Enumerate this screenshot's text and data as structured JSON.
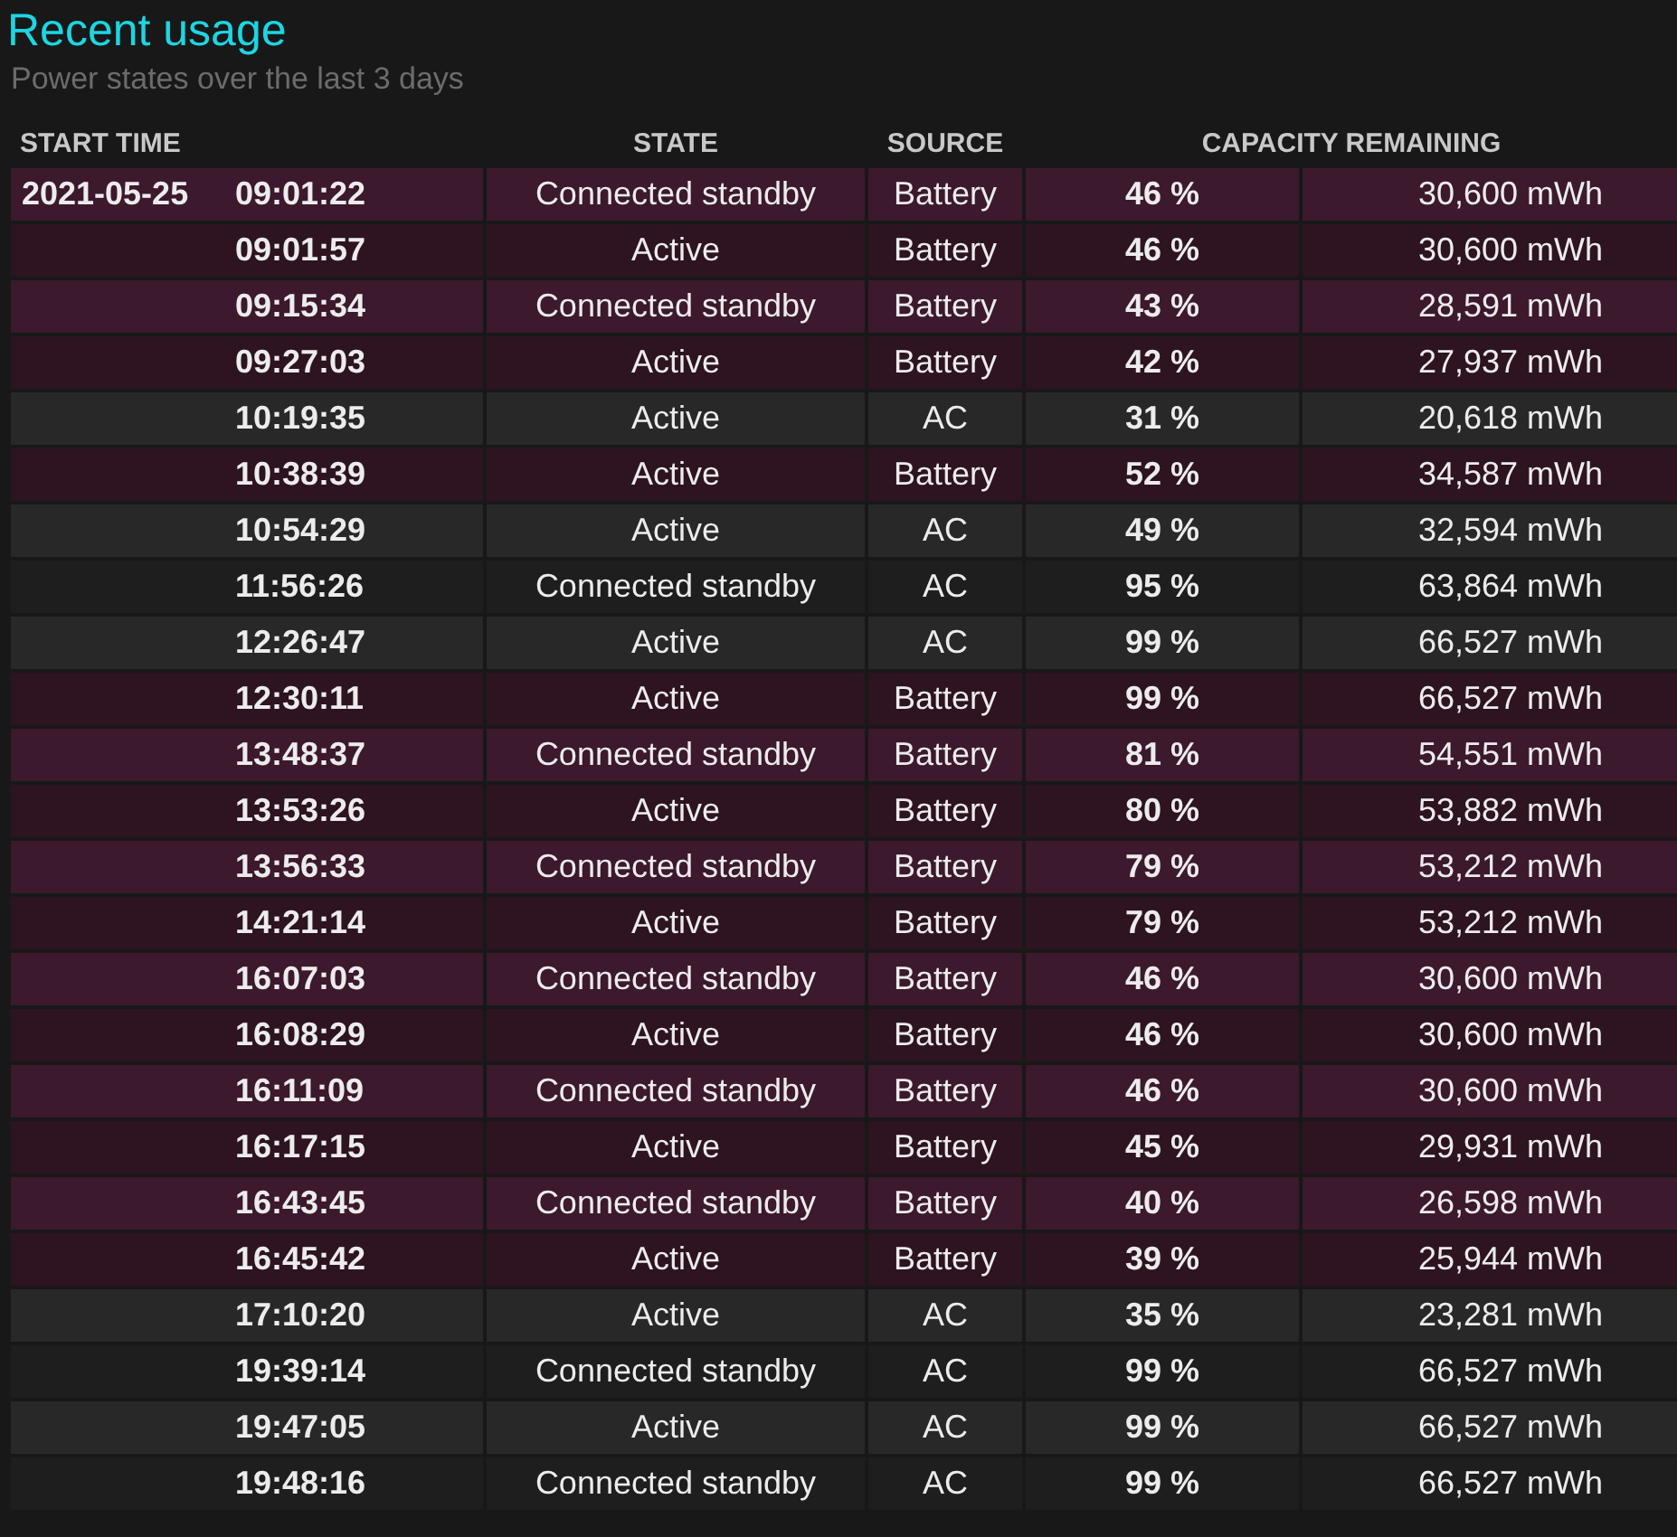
{
  "title": "Recent usage",
  "subtitle": "Power states over the last 3 days",
  "table": {
    "columns": [
      "START TIME",
      "STATE",
      "SOURCE",
      "CAPACITY REMAINING"
    ],
    "rows": [
      {
        "date": "2021-05-25",
        "time": "09:01:22",
        "state": "Connected standby",
        "source": "Battery",
        "percent": "46 %",
        "energy": "30,600 mWh",
        "color": "#3c192d"
      },
      {
        "time": "09:01:57",
        "state": "Active",
        "source": "Battery",
        "percent": "46 %",
        "energy": "30,600 mWh",
        "color": "#2d1420"
      },
      {
        "time": "09:15:34",
        "state": "Connected standby",
        "source": "Battery",
        "percent": "43 %",
        "energy": "28,591 mWh",
        "color": "#3c192d"
      },
      {
        "time": "09:27:03",
        "state": "Active",
        "source": "Battery",
        "percent": "42 %",
        "energy": "27,937 mWh",
        "color": "#2d1420"
      },
      {
        "time": "10:19:35",
        "state": "Active",
        "source": "AC",
        "percent": "31 %",
        "energy": "20,618 mWh",
        "color": "#282828"
      },
      {
        "time": "10:38:39",
        "state": "Active",
        "source": "Battery",
        "percent": "52 %",
        "energy": "34,587 mWh",
        "color": "#2d1420"
      },
      {
        "time": "10:54:29",
        "state": "Active",
        "source": "AC",
        "percent": "49 %",
        "energy": "32,594 mWh",
        "color": "#282828"
      },
      {
        "time": "11:56:26",
        "state": "Connected standby",
        "source": "AC",
        "percent": "95 %",
        "energy": "63,864 mWh",
        "color": "#1e1e1e"
      },
      {
        "time": "12:26:47",
        "state": "Active",
        "source": "AC",
        "percent": "99 %",
        "energy": "66,527 mWh",
        "color": "#282828"
      },
      {
        "time": "12:30:11",
        "state": "Active",
        "source": "Battery",
        "percent": "99 %",
        "energy": "66,527 mWh",
        "color": "#2d1420"
      },
      {
        "time": "13:48:37",
        "state": "Connected standby",
        "source": "Battery",
        "percent": "81 %",
        "energy": "54,551 mWh",
        "color": "#3c192d"
      },
      {
        "time": "13:53:26",
        "state": "Active",
        "source": "Battery",
        "percent": "80 %",
        "energy": "53,882 mWh",
        "color": "#2d1420"
      },
      {
        "time": "13:56:33",
        "state": "Connected standby",
        "source": "Battery",
        "percent": "79 %",
        "energy": "53,212 mWh",
        "color": "#3c192d"
      },
      {
        "time": "14:21:14",
        "state": "Active",
        "source": "Battery",
        "percent": "79 %",
        "energy": "53,212 mWh",
        "color": "#2d1420"
      },
      {
        "time": "16:07:03",
        "state": "Connected standby",
        "source": "Battery",
        "percent": "46 %",
        "energy": "30,600 mWh",
        "color": "#3c192d"
      },
      {
        "time": "16:08:29",
        "state": "Active",
        "source": "Battery",
        "percent": "46 %",
        "energy": "30,600 mWh",
        "color": "#2d1420"
      },
      {
        "time": "16:11:09",
        "state": "Connected standby",
        "source": "Battery",
        "percent": "46 %",
        "energy": "30,600 mWh",
        "color": "#3c192d"
      },
      {
        "time": "16:17:15",
        "state": "Active",
        "source": "Battery",
        "percent": "45 %",
        "energy": "29,931 mWh",
        "color": "#2d1420"
      },
      {
        "time": "16:43:45",
        "state": "Connected standby",
        "source": "Battery",
        "percent": "40 %",
        "energy": "26,598 mWh",
        "color": "#3c192d"
      },
      {
        "time": "16:45:42",
        "state": "Active",
        "source": "Battery",
        "percent": "39 %",
        "energy": "25,944 mWh",
        "color": "#2d1420"
      },
      {
        "time": "17:10:20",
        "state": "Active",
        "source": "AC",
        "percent": "35 %",
        "energy": "23,281 mWh",
        "color": "#282828"
      },
      {
        "time": "19:39:14",
        "state": "Connected standby",
        "source": "AC",
        "percent": "99 %",
        "energy": "66,527 mWh",
        "color": "#1e1e1e"
      },
      {
        "time": "19:47:05",
        "state": "Active",
        "source": "AC",
        "percent": "99 %",
        "energy": "66,527 mWh",
        "color": "#282828"
      },
      {
        "time": "19:48:16",
        "state": "Connected standby",
        "source": "AC",
        "percent": "99 %",
        "energy": "66,527 mWh",
        "color": "#1e1e1e"
      }
    ]
  }
}
